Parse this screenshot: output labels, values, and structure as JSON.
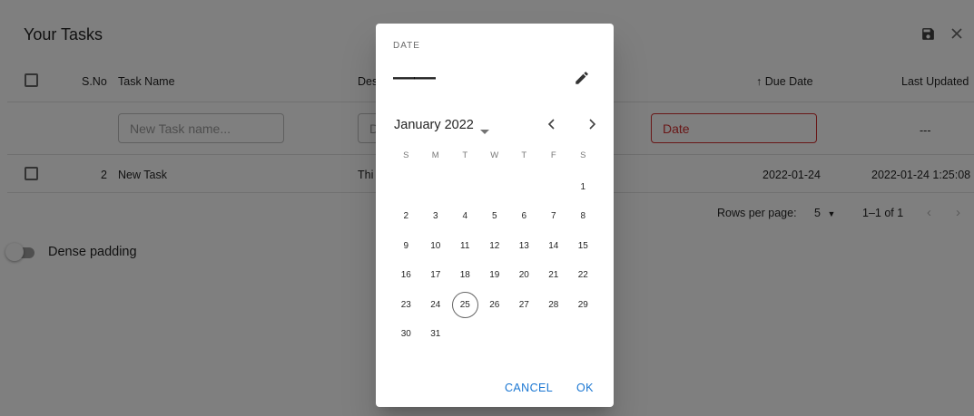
{
  "table": {
    "title": "Your Tasks",
    "columns": {
      "sno": "S.No",
      "task_name": "Task Name",
      "description": "Des",
      "due_date": "↑ Due Date",
      "last_updated": "Last Updated"
    },
    "new_row": {
      "task_name_placeholder": "New Task name...",
      "description_placeholder": "D",
      "date_placeholder": "Date",
      "last_updated": "---"
    },
    "rows": [
      {
        "sno": "2",
        "task_name": "New Task",
        "description": "Thi",
        "due_date": "2022-01-24",
        "last_updated": "2022-01-24 1:25:08"
      }
    ],
    "pagination": {
      "rows_per_page_label": "Rows per page:",
      "rows_per_page_value": "5",
      "range": "1–1 of 1"
    },
    "dense_padding_label": "Dense padding"
  },
  "date_picker": {
    "label": "DATE",
    "value": "——",
    "month_year": "January 2022",
    "weekdays": [
      "S",
      "M",
      "T",
      "W",
      "T",
      "F",
      "S"
    ],
    "weeks": [
      [
        "",
        "",
        "",
        "",
        "",
        "",
        "1"
      ],
      [
        "2",
        "3",
        "4",
        "5",
        "6",
        "7",
        "8"
      ],
      [
        "9",
        "10",
        "11",
        "12",
        "13",
        "14",
        "15"
      ],
      [
        "16",
        "17",
        "18",
        "19",
        "20",
        "21",
        "22"
      ],
      [
        "23",
        "24",
        "25",
        "26",
        "27",
        "28",
        "29"
      ],
      [
        "30",
        "31",
        "",
        "",
        "",
        "",
        ""
      ]
    ],
    "today": "25",
    "cancel_label": "CANCEL",
    "ok_label": "OK"
  },
  "icons": {
    "save": "save-icon",
    "close": "close-icon",
    "edit": "pencil-icon",
    "dropdown": "caret-down-icon",
    "prev": "chevron-left-icon",
    "next": "chevron-right-icon"
  },
  "colors": {
    "accent": "#1976d2",
    "error": "#d32f2f",
    "backdrop": "rgba(0,0,0,0.5)"
  }
}
